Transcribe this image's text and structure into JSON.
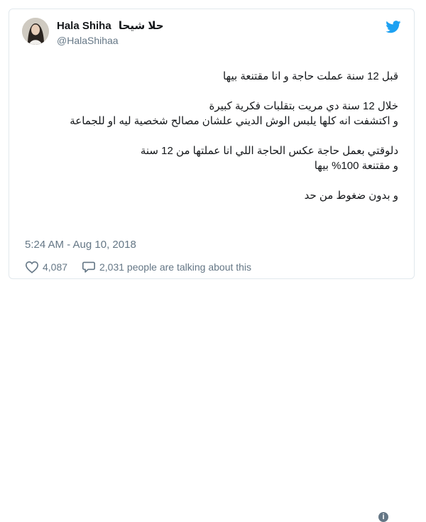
{
  "user": {
    "name": "Hala Shiha",
    "name_arabic": "حلا شيحا",
    "handle": "@HalaShihaa"
  },
  "tweet": {
    "paragraphs": [
      [
        "قبل 12 سنة عملت حاجة و انا مقتنعة بيها"
      ],
      [
        "خلال 12 سنة دي مريت بتقلبات فكرية كبيرة",
        "و اكتشفت انه كلها يلبس الوش الديني علشان مصالح شخصية ليه او للجماعة"
      ],
      [
        "دلوقتي بعمل حاجة عكس الحاجة اللي انا عملتها من 12 سنة",
        "و مقتنعة 100% بيها"
      ],
      [
        "و بدون ضغوط من حد"
      ]
    ],
    "timestamp": "5:24 AM - Aug 10, 2018"
  },
  "actions": {
    "likes": "4,087",
    "replies_text": "2,031 people are talking about this"
  },
  "colors": {
    "twitter_blue": "#1da1f2",
    "secondary_text": "#657786"
  },
  "icons": {
    "brand": "twitter-bird-icon",
    "like": "heart-icon",
    "reply": "speech-bubble-icon",
    "info": "info-icon"
  }
}
